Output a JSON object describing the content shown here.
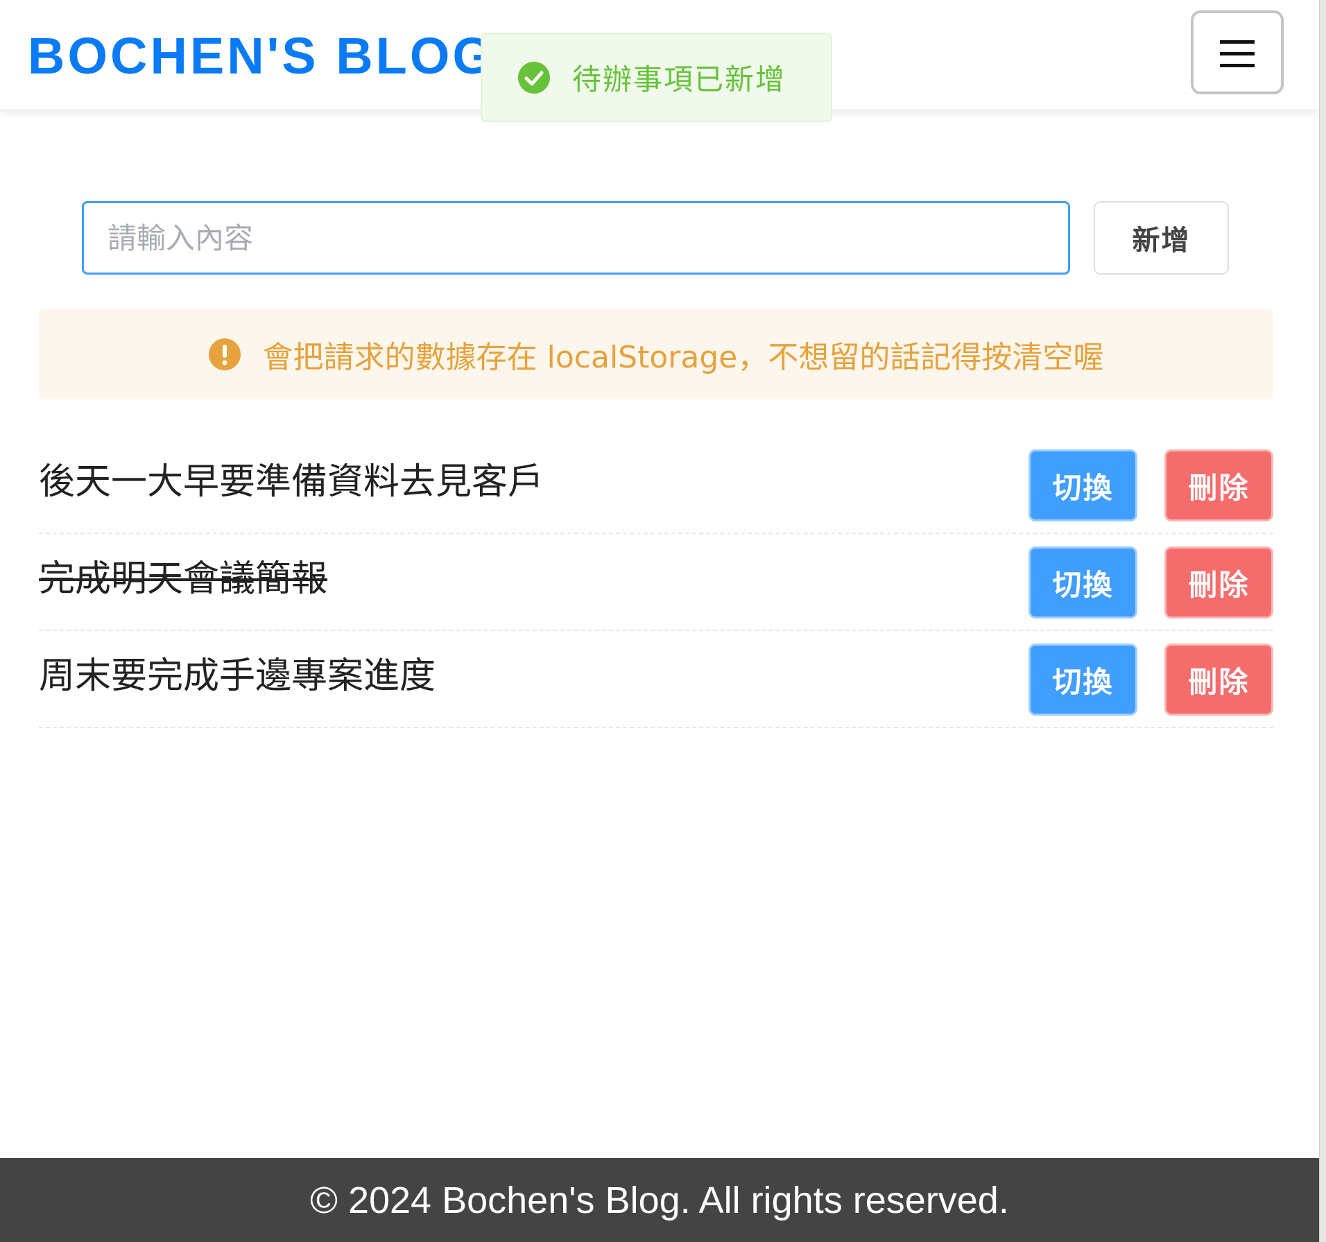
{
  "header": {
    "brand": "BOCHEN'S BLOG",
    "menu_icon": "☰"
  },
  "toast": {
    "message": "待辦事項已新增",
    "icon": "check-circle-icon",
    "color": "#67c23a"
  },
  "form": {
    "placeholder": "請輸入內容",
    "value": "",
    "add_label": "新增"
  },
  "notice": {
    "icon": "exclamation-circle-icon",
    "text": "會把請求的數據存在 localStorage，不想留的話記得按清空喔",
    "color": "#e6a23c"
  },
  "todos": [
    {
      "text": "後天一大早要準備資料去見客戶",
      "done": false,
      "toggle_label": "切換",
      "delete_label": "刪除"
    },
    {
      "text": "完成明天會議簡報",
      "done": true,
      "toggle_label": "切換",
      "delete_label": "刪除"
    },
    {
      "text": "周末要完成手邊專案進度",
      "done": false,
      "toggle_label": "切換",
      "delete_label": "刪除"
    }
  ],
  "footer": {
    "text": "© 2024 Bochen's Blog. All rights reserved."
  },
  "colors": {
    "brand": "#0a7bf5",
    "primary": "#409eff",
    "danger": "#f56c6c",
    "footer_bg": "#444444"
  }
}
